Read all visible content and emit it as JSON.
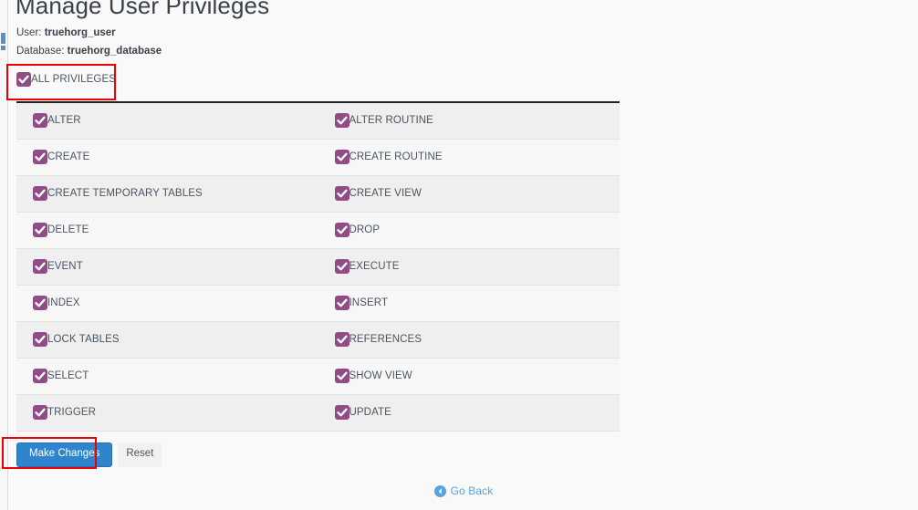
{
  "page": {
    "title": "Manage User Privileges",
    "meta": [
      {
        "label": "User:",
        "value": "truehorg_user"
      },
      {
        "label": "Database:",
        "value": "truehorg_database"
      }
    ]
  },
  "all_privileges": {
    "label": "ALL PRIVILEGES",
    "checked": true
  },
  "privileges_table": {
    "rows": [
      {
        "left": {
          "label": "ALTER",
          "checked": true
        },
        "right": {
          "label": "ALTER ROUTINE",
          "checked": true
        }
      },
      {
        "left": {
          "label": "CREATE",
          "checked": true
        },
        "right": {
          "label": "CREATE ROUTINE",
          "checked": true
        }
      },
      {
        "left": {
          "label": "CREATE TEMPORARY TABLES",
          "checked": true
        },
        "right": {
          "label": "CREATE VIEW",
          "checked": true
        }
      },
      {
        "left": {
          "label": "DELETE",
          "checked": true
        },
        "right": {
          "label": "DROP",
          "checked": true
        }
      },
      {
        "left": {
          "label": "EVENT",
          "checked": true
        },
        "right": {
          "label": "EXECUTE",
          "checked": true
        }
      },
      {
        "left": {
          "label": "INDEX",
          "checked": true
        },
        "right": {
          "label": "INSERT",
          "checked": true
        }
      },
      {
        "left": {
          "label": "LOCK TABLES",
          "checked": true
        },
        "right": {
          "label": "REFERENCES",
          "checked": true
        }
      },
      {
        "left": {
          "label": "SELECT",
          "checked": true
        },
        "right": {
          "label": "SHOW VIEW",
          "checked": true
        }
      },
      {
        "left": {
          "label": "TRIGGER",
          "checked": true
        },
        "right": {
          "label": "UPDATE",
          "checked": true
        }
      }
    ]
  },
  "actions": {
    "make_changes_label": "Make Changes",
    "reset_label": "Reset"
  },
  "go_back": {
    "label": "Go Back",
    "icon": "arrow-left-circle-icon"
  },
  "colors": {
    "checkbox_purple": "#8f4c85",
    "primary_button_blue": "#2f85cd",
    "link_blue": "#5aa2de",
    "highlight_red": "#ee0000",
    "row_odd": "#efefef",
    "row_even": "#f7f7f7",
    "page_background": "#f9f9f9"
  }
}
